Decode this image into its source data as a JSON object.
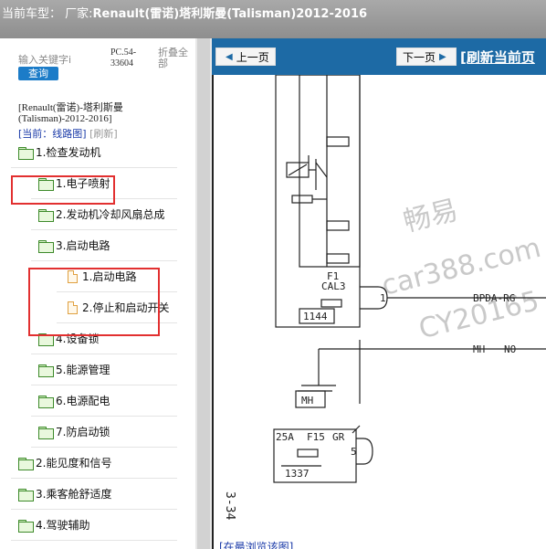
{
  "titlebar": {
    "prefix": "当前车型：",
    "maker_label": "厂家:",
    "model": "Renault(雷诺)塔利斯曼(Talisman)2012-2016"
  },
  "sidebar": {
    "search_placeholder": "输入关键字i",
    "search_button": "查询",
    "pc_code": "PC.54-33604",
    "collapse_all": "折叠全部",
    "car_name": "[Renault(雷诺)-塔利斯曼(Talisman)-2012-2016]",
    "current_label": "[当前：线路图]",
    "refresh_label": "[刷新]",
    "tree": [
      {
        "label": "1.检查发动机",
        "type": "folder",
        "level": 0
      },
      {
        "label": "1.电子喷射",
        "type": "folder",
        "level": 1
      },
      {
        "label": "2.发动机冷却风扇总成",
        "type": "folder",
        "level": 1
      },
      {
        "label": "3.启动电路",
        "type": "folder",
        "level": 1
      },
      {
        "label": "1.启动电路",
        "type": "page",
        "level": 2
      },
      {
        "label": "2.停止和启动开关",
        "type": "page",
        "level": 2
      },
      {
        "label": "4.设备锁",
        "type": "folder",
        "level": 1
      },
      {
        "label": "5.能源管理",
        "type": "folder",
        "level": 1
      },
      {
        "label": "6.电源配电",
        "type": "folder",
        "level": 1
      },
      {
        "label": "7.防启动锁",
        "type": "folder",
        "level": 1
      },
      {
        "label": "2.能见度和信号",
        "type": "folder",
        "level": 0
      },
      {
        "label": "3.乘客舱舒适度",
        "type": "folder",
        "level": 0
      },
      {
        "label": "4.驾驶辅助",
        "type": "folder",
        "level": 0
      }
    ]
  },
  "content": {
    "prev_button": "上一页",
    "next_button": "下一页",
    "refresh_link": "[刷新当前页",
    "bottom_link": "[在最浏览该图]"
  },
  "diagram": {
    "fuse_f1": "F1",
    "cal3": "CAL3",
    "box_1144": "1144",
    "pin_1": "1",
    "wire_bpda": "BPDA-RG",
    "wire_mh": "MH",
    "wire_no": "NO",
    "ground": "MH",
    "fuse_25a": "25A",
    "fuse_f15": "F15",
    "wire_gr": "GR",
    "pin_5": "5",
    "box_1337": "1337",
    "page_ref": "3-34"
  },
  "watermark": {
    "line1": "畅易",
    "line2": "car388.com",
    "line3": "CY20165"
  },
  "colors": {
    "titlebar": "#999999",
    "toolbar": "#1d6aa5",
    "search_button": "#1c7cc8",
    "highlight": "#e23030",
    "folder_green": "#3d8a2a",
    "page_orange": "#e0a040"
  }
}
